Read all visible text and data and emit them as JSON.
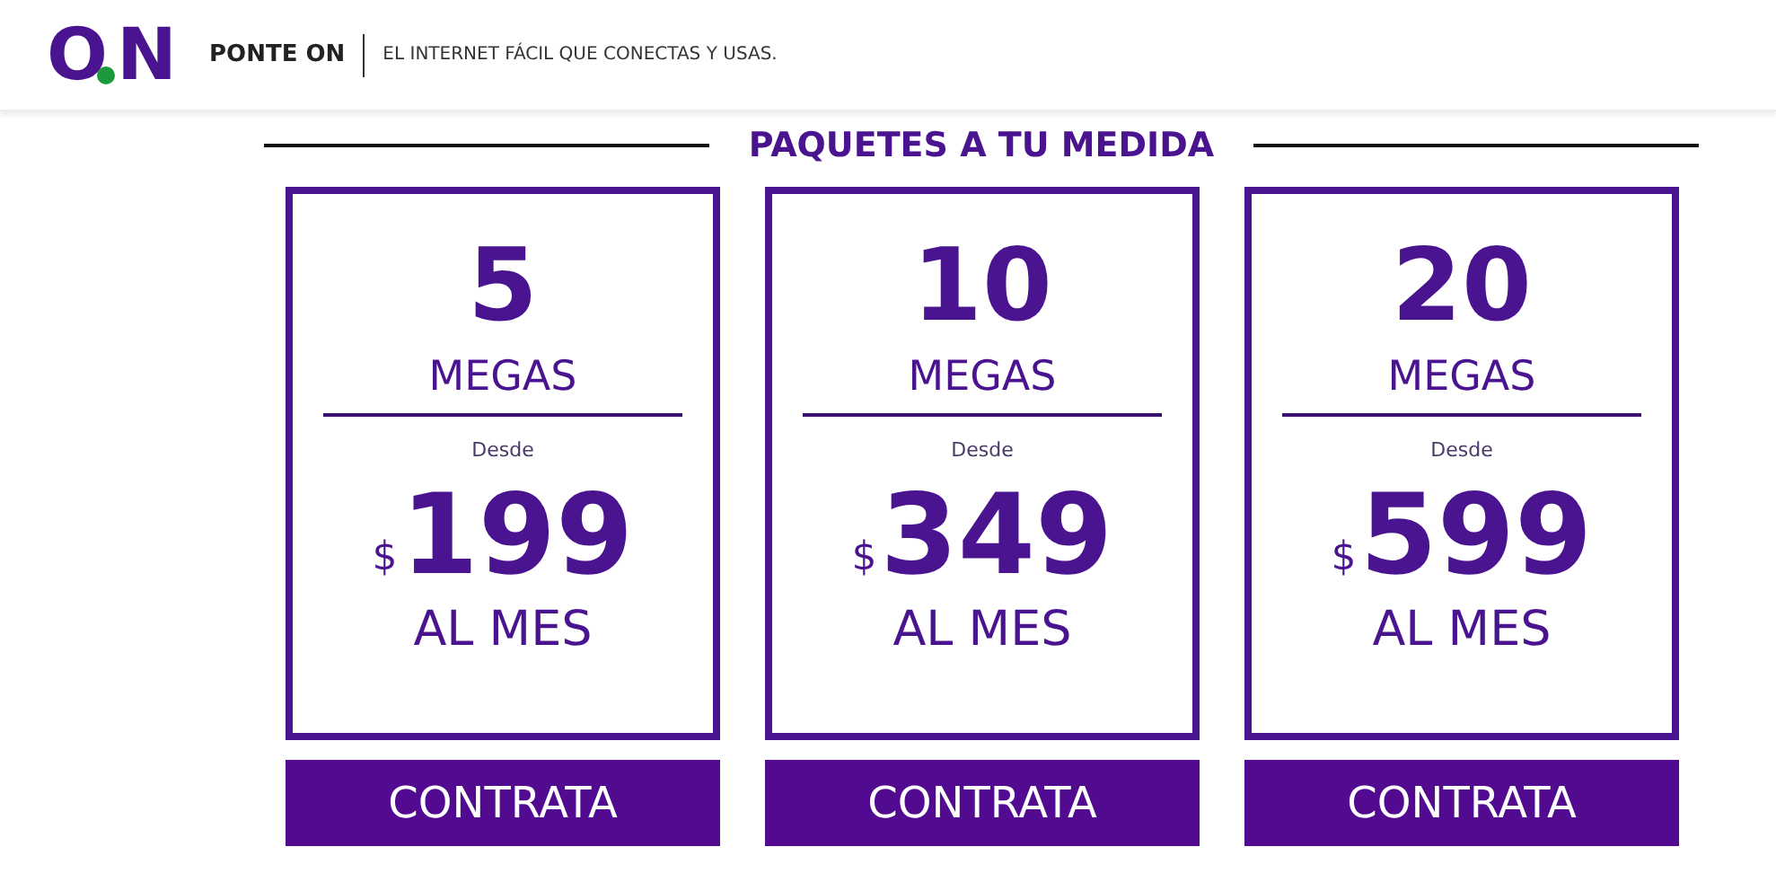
{
  "header": {
    "logo": {
      "first": "O",
      "second": "N"
    },
    "brand": "PONTE ON",
    "tagline": "EL INTERNET FÁCIL QUE CONECTAS Y USAS."
  },
  "section": {
    "title": "PAQUETES A TU MEDIDA"
  },
  "plans": [
    {
      "speed": "5",
      "unit": "MEGAS",
      "from": "Desde",
      "currency": "$",
      "price": "199",
      "period": "AL MES",
      "button": "CONTRATA"
    },
    {
      "speed": "10",
      "unit": "MEGAS",
      "from": "Desde",
      "currency": "$",
      "price": "349",
      "period": "AL MES",
      "button": "CONTRATA"
    },
    {
      "speed": "20",
      "unit": "MEGAS",
      "from": "Desde",
      "currency": "$",
      "price": "599",
      "period": "AL MES",
      "button": "CONTRATA"
    }
  ]
}
